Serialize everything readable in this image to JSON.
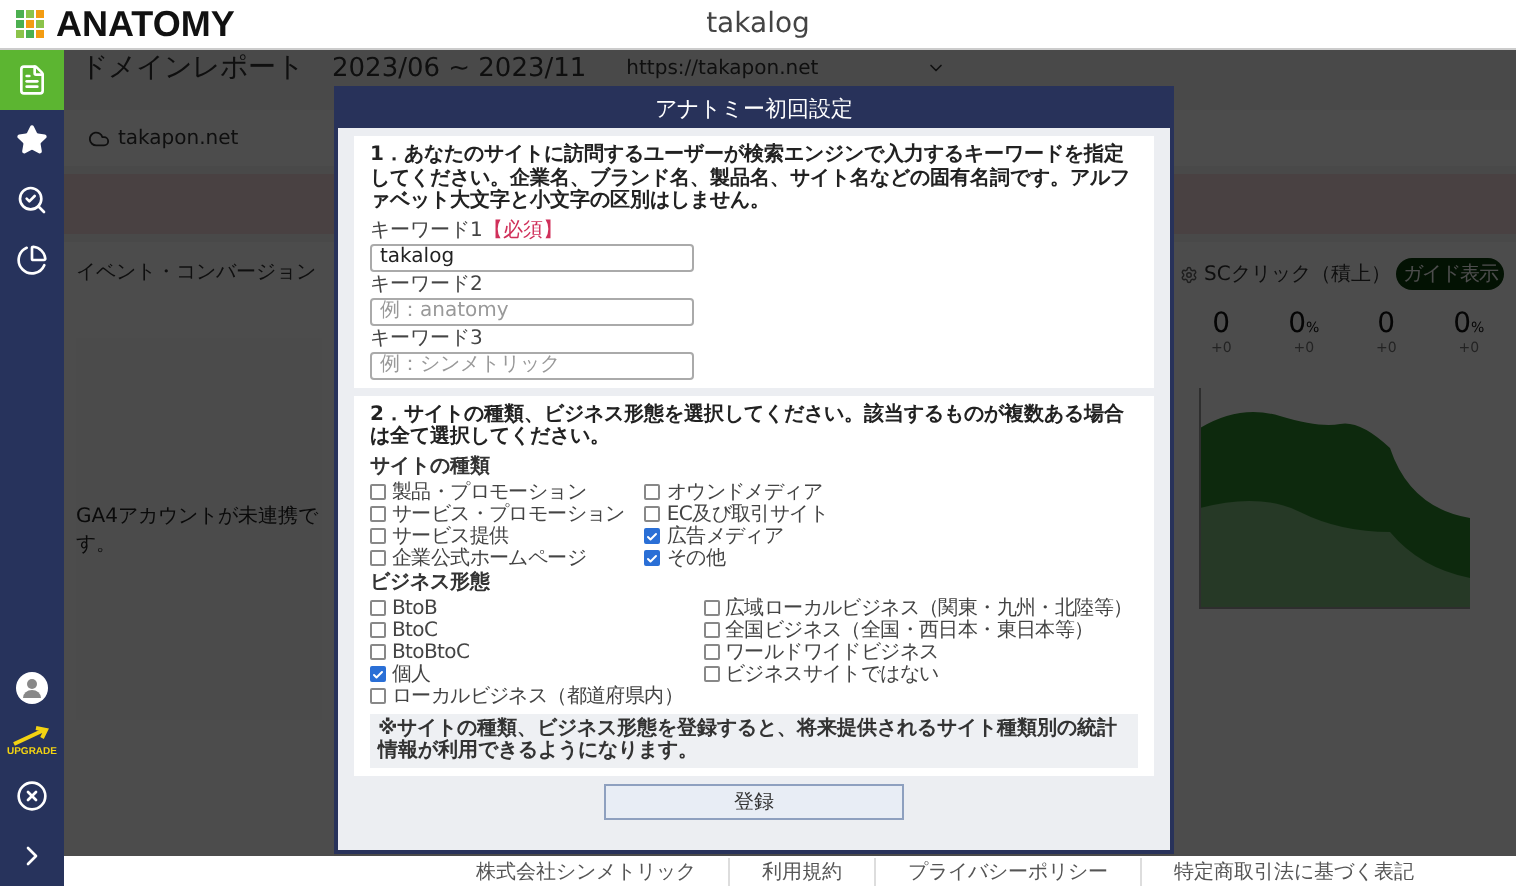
{
  "header": {
    "logo": "ANATOMY",
    "title": "takalog"
  },
  "sidebar": {
    "items": [
      {
        "kind": "report",
        "selected": true
      },
      {
        "kind": "star",
        "selected": false
      },
      {
        "kind": "search",
        "selected": false
      },
      {
        "kind": "pie",
        "selected": false
      }
    ],
    "bottom": [
      {
        "kind": "avatar"
      },
      {
        "kind": "upgrade",
        "label": "UPGRADE"
      },
      {
        "kind": "close"
      },
      {
        "kind": "expand"
      }
    ]
  },
  "report": {
    "title": "ドメインレポート",
    "period": "2023/06 ~ 2023/11",
    "site_select": "https://takapon.net",
    "site": "takapon.net"
  },
  "event_card": {
    "title": "イベント・コンバージョン",
    "message": "GA4アカウントが未連携です。"
  },
  "sc_card": {
    "title": "SCクリック（積上）",
    "badge": "ガイド表示",
    "stats": [
      {
        "value": "0",
        "delta": "+0"
      },
      {
        "value": "0",
        "unit": "%",
        "delta": "+0"
      },
      {
        "value": "0",
        "delta": "+0"
      },
      {
        "value": "0",
        "unit": "%",
        "delta": "+0"
      }
    ]
  },
  "dialog": {
    "title": "アナトミー初回設定",
    "keywords": {
      "instruction": "1．あなたのサイトに訪問するユーザーが検索エンジンで入力するキーワードを指定してください。企業名、ブランド名、製品名、サイト名などの固有名詞です。アルファベット大文字と小文字の区別はしません。",
      "fields": [
        {
          "label": "キーワード1",
          "required": "【必須】",
          "value": "takalog"
        },
        {
          "label": "キーワード2",
          "placeholder": "例：anatomy"
        },
        {
          "label": "キーワード3",
          "placeholder": "例：シンメトリック"
        }
      ]
    },
    "classification": {
      "instruction": "2．サイトの種類、ビジネス形態を選択してください。該当するものが複数ある場合は全て選択してください。",
      "groups": [
        {
          "title": "サイトの種類",
          "options": [
            {
              "label": "製品・プロモーション",
              "checked": false
            },
            {
              "label": "サービス・プロモーション",
              "checked": false
            },
            {
              "label": "サービス提供",
              "checked": false
            },
            {
              "label": "企業公式ホームページ",
              "checked": false
            },
            {
              "label": "オウンドメディア",
              "checked": false
            },
            {
              "label": "EC及び取引サイト",
              "checked": false
            },
            {
              "label": "広告メディア",
              "checked": true
            },
            {
              "label": "その他",
              "checked": true
            }
          ]
        },
        {
          "title": "ビジネス形態",
          "options": [
            {
              "label": "BtoB",
              "checked": false
            },
            {
              "label": "BtoC",
              "checked": false
            },
            {
              "label": "BtoBtoC",
              "checked": false
            },
            {
              "label": "個人",
              "checked": true
            },
            {
              "label": "ローカルビジネス（都道府県内）",
              "checked": false
            },
            {
              "label": "広域ローカルビジネス（関東・九州・北陸等）",
              "checked": false
            },
            {
              "label": "全国ビジネス（全国・西日本・東日本等）",
              "checked": false
            },
            {
              "label": "ワールドワイドビジネス",
              "checked": false
            },
            {
              "label": "ビジネスサイトではない",
              "checked": false
            }
          ]
        }
      ],
      "note": "※サイトの種類、ビジネス形態を登録すると、将来提供されるサイト種類別の統計情報が利用できるようになります。"
    },
    "submit": "登録"
  },
  "footer": {
    "links": [
      "株式会社シンメトリック",
      "利用規約",
      "プライバシーポリシー",
      "特定商取引法に基づく表記"
    ]
  }
}
